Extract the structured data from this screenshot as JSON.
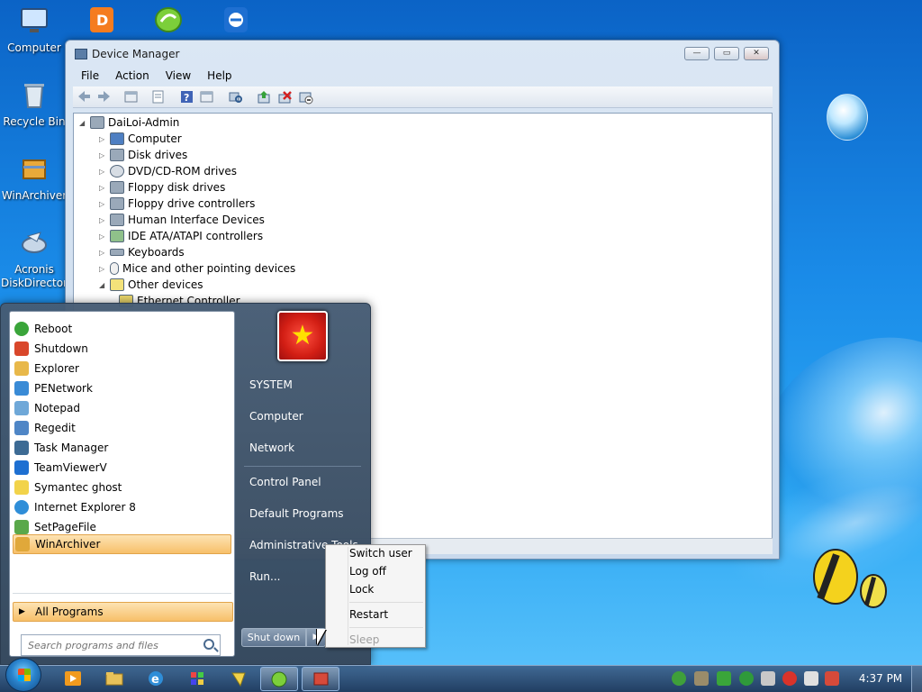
{
  "desktop": {
    "icons": [
      {
        "label": "Computer",
        "icon": "computer-icon"
      },
      {
        "label": "Recycle Bin",
        "icon": "recycle-bin-icon"
      },
      {
        "label": "WinArchiver",
        "icon": "winarchiver-icon"
      },
      {
        "label": "Acronis DiskDirector",
        "icon": "acronis-icon"
      }
    ],
    "top_icons": [
      "office-icon",
      "green-app-icon",
      "teamviewer-icon"
    ]
  },
  "window": {
    "title": "Device Manager",
    "buttons": {
      "minimize": "—",
      "maximize": "▭",
      "close": "✕"
    },
    "menu": [
      "File",
      "Action",
      "View",
      "Help"
    ],
    "tree": {
      "root": "DaiLoi-Admin",
      "items": [
        {
          "label": "Computer",
          "arrow": "▷"
        },
        {
          "label": "Disk drives",
          "arrow": "▷"
        },
        {
          "label": "DVD/CD-ROM drives",
          "arrow": "▷"
        },
        {
          "label": "Floppy disk drives",
          "arrow": "▷"
        },
        {
          "label": "Floppy drive controllers",
          "arrow": "▷"
        },
        {
          "label": "Human Interface Devices",
          "arrow": "▷"
        },
        {
          "label": "IDE ATA/ATAPI controllers",
          "arrow": "▷"
        },
        {
          "label": "Keyboards",
          "arrow": "▷"
        },
        {
          "label": "Mice and other pointing devices",
          "arrow": "▷"
        },
        {
          "label": "Other devices",
          "arrow": "◢"
        },
        {
          "label": "Ethernet Controller",
          "arrow": ""
        }
      ],
      "root_arrow": "◢"
    }
  },
  "start_menu": {
    "programs": [
      {
        "label": "Reboot",
        "color": "#3aa53a"
      },
      {
        "label": "Shutdown",
        "color": "#d9472b"
      },
      {
        "label": "Explorer",
        "color": "#e8b84a"
      },
      {
        "label": "PENetwork",
        "color": "#3a8bd6"
      },
      {
        "label": "Notepad",
        "color": "#6fa8d8"
      },
      {
        "label": "Regedit",
        "color": "#4f86c6"
      },
      {
        "label": "Task Manager",
        "color": "#3d6b94"
      },
      {
        "label": "TeamViewerV",
        "color": "#1e6fd1"
      },
      {
        "label": "Symantec ghost",
        "color": "#f2d34a"
      },
      {
        "label": "Internet Explorer 8",
        "color": "#2f8ed8"
      },
      {
        "label": "SetPageFile",
        "color": "#5aa84a"
      }
    ],
    "pinned": {
      "label": "WinArchiver",
      "color": "#e0a83a"
    },
    "all_programs": "All Programs",
    "all_programs_arrow": "▶",
    "search_placeholder": "Search programs and files",
    "right": [
      "SYSTEM",
      "Computer",
      "Network",
      "Control Panel",
      "Default Programs",
      "Administrative Tools",
      "Run..."
    ],
    "user_picture_star": "★",
    "shutdown_label": "Shut down",
    "shutdown_arrow": "▶"
  },
  "power_menu": {
    "items": [
      "Switch user",
      "Log off",
      "Lock",
      "Restart",
      "Sleep"
    ]
  },
  "taskbar": {
    "clock": "4:37 PM",
    "pinned": [
      "media-player-icon",
      "explorer-icon",
      "internet-explorer-icon",
      "paint-icon",
      "symantec-icon"
    ],
    "tasks": [
      "device-manager-task",
      "winarchiver-task"
    ],
    "tray": [
      "network-icon",
      "tools-icon",
      "security-icon",
      "media-icon",
      "tool-icon",
      "antivirus-icon",
      "volume-muted-icon",
      "power-icon"
    ]
  }
}
